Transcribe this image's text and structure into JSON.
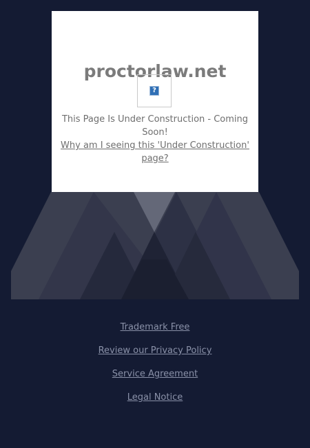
{
  "card": {
    "domain": "proctorlaw.net",
    "image_icon": "broken-image-icon",
    "image_glyph": "?",
    "status": "This Page Is Under Construction - Coming Soon!",
    "why_link": "Why am I seeing this 'Under Construction' page?"
  },
  "footer": {
    "links": [
      "Trademark Free",
      "Review our Privacy Policy",
      "Service Agreement",
      "Legal Notice"
    ]
  },
  "colors": {
    "background": "#141b33",
    "card": "#ffffff",
    "domain_text": "#7b7b7b",
    "body_text": "#6e6e6e",
    "footer_link": "#8a91a8"
  }
}
